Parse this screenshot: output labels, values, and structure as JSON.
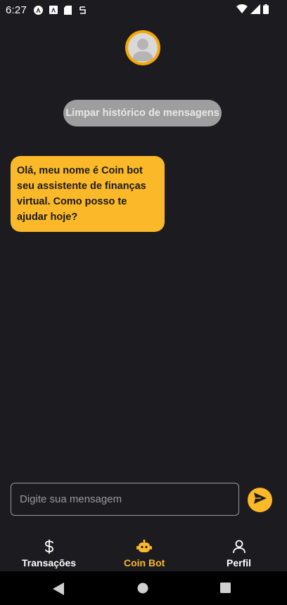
{
  "status_bar": {
    "time": "6:27"
  },
  "header": {
    "avatar_icon": "person-avatar-icon",
    "clear_history_label": "Limpar histórico de mensagens"
  },
  "chat": {
    "messages": [
      {
        "sender": "bot",
        "text": "Olá, meu nome é Coin bot seu assistente de finanças virtual. Como posso te ajudar hoje?"
      }
    ]
  },
  "composer": {
    "placeholder": "Digite sua mensagem",
    "send_icon": "send-icon"
  },
  "bottom_nav": {
    "items": [
      {
        "label": "Transações",
        "icon": "dollar-icon",
        "active": false
      },
      {
        "label": "Coin Bot",
        "icon": "robot-icon",
        "active": true
      },
      {
        "label": "Perfil",
        "icon": "person-icon",
        "active": false
      }
    ]
  },
  "colors": {
    "background": "#1c1b1f",
    "accent": "#fbb929",
    "avatar_ring": "#f5a800",
    "clear_button": "#9e9e9e"
  }
}
